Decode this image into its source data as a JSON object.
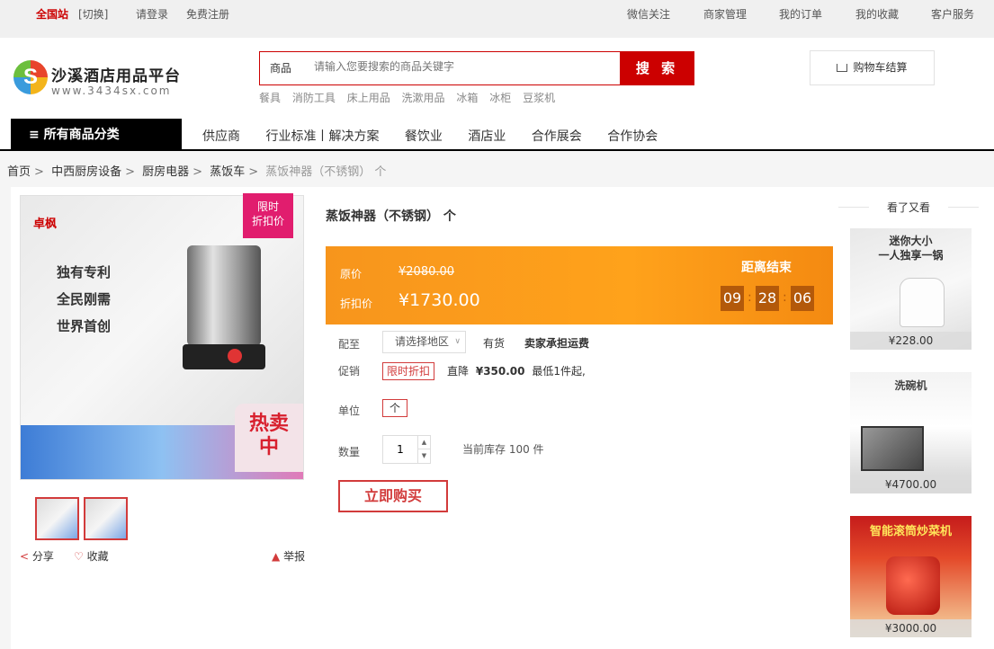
{
  "topbar": {
    "site": "全国站",
    "switch": "[切换]",
    "login": "请登录",
    "register": "免费注册",
    "links": [
      "微信关注",
      "商家管理",
      "我的订单",
      "我的收藏",
      "客户服务"
    ]
  },
  "header": {
    "logo_name": "沙溪酒店用品平台",
    "logo_url": "www.3434sx.com",
    "search_category": "商品",
    "search_placeholder": "请输入您要搜索的商品关键字",
    "search_button": "搜 索",
    "hot_words": [
      "餐具",
      "消防工具",
      "床上用品",
      "洗漱用品",
      "冰箱",
      "冰柜",
      "豆浆机"
    ],
    "cart": "购物车结算"
  },
  "nav": {
    "all_categories": "≡ 所有商品分类",
    "links": [
      "供应商",
      "行业标准丨解决方案",
      "餐饮业",
      "酒店业",
      "合作展会",
      "合作协会"
    ]
  },
  "breadcrumb": [
    "首页",
    "中西厨房设备",
    "厨房电器",
    "蒸饭车"
  ],
  "breadcrumb_current": "蒸饭神器（不锈钢） 个",
  "gallery": {
    "brand": "卓枫",
    "slogan": "独有专利\n全民刚需\n世界首创",
    "limited_badge": "限时\n折扣价",
    "hot_badge": "热卖\n中",
    "share": "分享",
    "favorite": "收藏",
    "report": "举报"
  },
  "product": {
    "title": "蒸饭神器（不锈钢） 个",
    "orig_label": "原价",
    "orig_price": "¥2080.00",
    "disc_label": "折扣价",
    "disc_price": "¥1730.00",
    "countdown_label": "距离结束",
    "countdown": [
      "09",
      "28",
      "06"
    ],
    "ship_label": "配至",
    "region_select": "请选择地区",
    "in_stock": "有货",
    "free_ship": "卖家承担运费",
    "promo_label": "促销",
    "promo_tag": "限时折扣",
    "promo_text_1": "直降",
    "promo_text_2": "¥350.00",
    "promo_text_3": "最低1件起,",
    "unit_label": "单位",
    "unit_value": "个",
    "qty_label": "数量",
    "qty_value": "1",
    "stock_text": "当前库存 100 件",
    "buy_button": "立即购买"
  },
  "related": {
    "title": "看了又看",
    "items": [
      {
        "caption": "迷你大小\n一人独享一锅",
        "price": "¥228.00"
      },
      {
        "caption": "洗碗机",
        "price": "¥4700.00"
      },
      {
        "caption": "智能滚筒炒菜机",
        "price": "¥3000.00"
      }
    ]
  },
  "colors": {
    "accent": "#cc0000",
    "orange": "#f7951c",
    "badge": "#e11d6e"
  }
}
